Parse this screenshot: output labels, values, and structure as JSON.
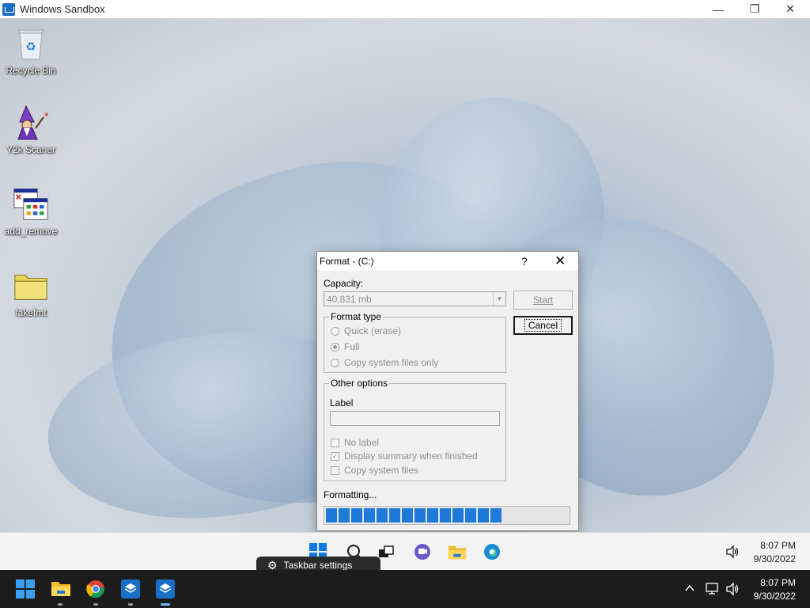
{
  "sandbox_window": {
    "title": "Windows Sandbox",
    "minimize_glyph": "—",
    "restore_glyph": "❐",
    "close_glyph": "✕"
  },
  "desktop": {
    "icons": [
      {
        "label": "Recycle Bin",
        "icon": "recycle-bin-icon"
      },
      {
        "label": "Y2k Scaner",
        "icon": "wizard-icon"
      },
      {
        "label": "add_remove",
        "icon": "control-panel-icon"
      },
      {
        "label": "fakefmt",
        "icon": "folder-icon"
      }
    ]
  },
  "format_dialog": {
    "title": "Format -  (C:)",
    "help_glyph": "?",
    "close_glyph": "✕",
    "capacity_label": "Capacity:",
    "capacity_value": "40,831 mb",
    "start_label": "Start",
    "cancel_label": "Cancel",
    "format_type_legend": "Format type",
    "format_options": [
      {
        "label": "Quick (erase)",
        "selected": false
      },
      {
        "label": "Full",
        "selected": true
      },
      {
        "label": "Copy system files only",
        "selected": false
      }
    ],
    "other_options_legend": "Other options",
    "label_caption": "Label",
    "label_value": "",
    "checkboxes": [
      {
        "label": "No label",
        "checked": false
      },
      {
        "label": "Display summary when finished",
        "checked": true
      },
      {
        "label": "Copy system files",
        "checked": false
      }
    ],
    "status_text": "Formatting...",
    "progress_blocks": 14
  },
  "inner_taskbar": {
    "context_popup_label": "Taskbar settings",
    "time": "8:07 PM",
    "date": "9/30/2022"
  },
  "host_taskbar": {
    "time": "8:07 PM",
    "date": "9/30/2022"
  },
  "colors": {
    "accent": "#1e7ad8",
    "host_taskbar": "#1c1c1c",
    "dialog_bg": "#f0f0f0"
  }
}
